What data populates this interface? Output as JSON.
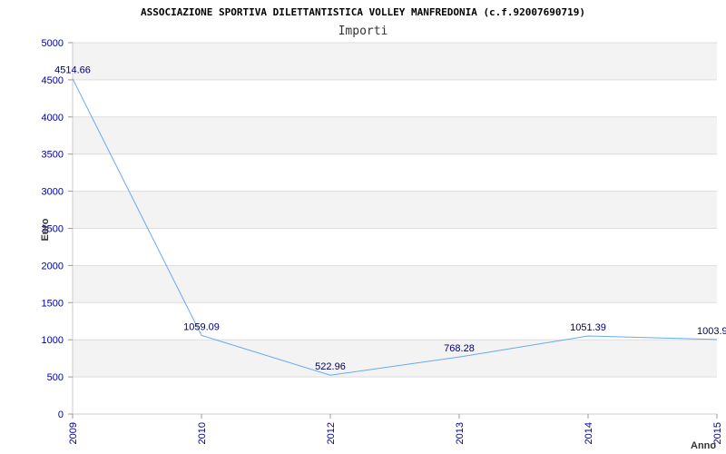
{
  "chart_data": {
    "type": "line",
    "title": "ASSOCIAZIONE SPORTIVA DILETTANTISTICA VOLLEY MANFREDONIA (c.f.92007690719)",
    "subtitle": "Importi",
    "xlabel": "Anno",
    "ylabel": "Euro",
    "categories": [
      "2009",
      "2010",
      "2012",
      "2013",
      "2014",
      "2015"
    ],
    "values": [
      4514.66,
      1059.09,
      522.96,
      768.28,
      1051.39,
      1003.9
    ],
    "data_labels": [
      "4514.66",
      "1059.09",
      "522.96",
      "768.28",
      "1051.39",
      "1003.9"
    ],
    "ylim": [
      0,
      5000
    ],
    "yticks": [
      "0",
      "500",
      "1000",
      "1500",
      "2000",
      "2500",
      "3000",
      "3500",
      "4000",
      "4500",
      "5000"
    ],
    "grid": true,
    "line_color": "#66aaee",
    "band_color": "#f3f3f3",
    "grid_color": "#dddddd",
    "tick_color": "#000099"
  }
}
